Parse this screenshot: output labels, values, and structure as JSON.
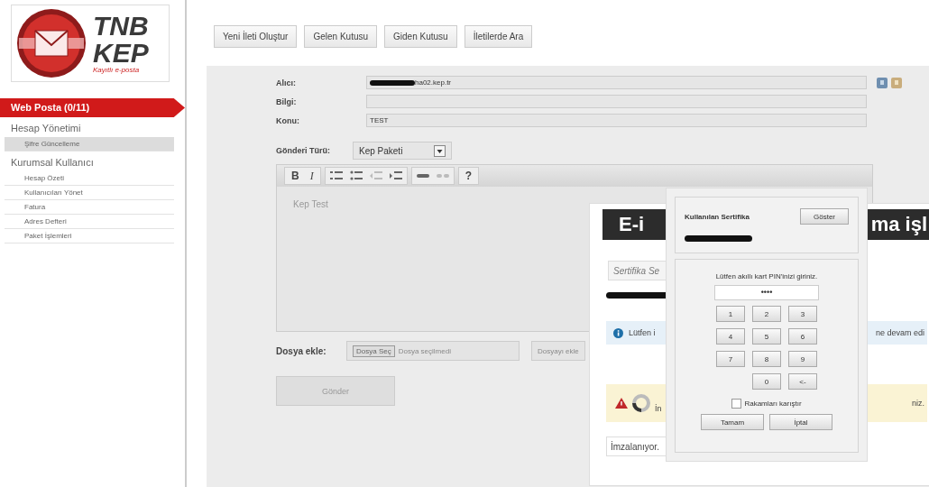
{
  "logo": {
    "line1": "TNB",
    "line2": "KEP",
    "tagline": "Kayıtlı e-posta"
  },
  "sidebar": {
    "items": [
      {
        "label": "Web Posta (0/11)",
        "kind": "primary",
        "selected": true
      },
      {
        "label": "Hesap Yönetimi",
        "kind": "section",
        "children": [
          {
            "label": "Şifre Güncelleme",
            "selected": true
          }
        ]
      },
      {
        "label": "Kurumsal Kullanıcı",
        "kind": "section",
        "children": [
          {
            "label": "Hesap Özeti",
            "selected": false
          },
          {
            "label": "Kullanıcıları Yönet",
            "selected": false
          },
          {
            "label": "Fatura",
            "selected": false
          },
          {
            "label": "Adres Defteri",
            "selected": false
          },
          {
            "label": "Paket İşlemleri",
            "selected": false
          }
        ]
      }
    ]
  },
  "toolbar": [
    "Yeni İleti Oluştur",
    "Gelen Kutusu",
    "Giden Kutusu",
    "İletilerde Ara"
  ],
  "compose": {
    "fields": [
      {
        "label": "Alıcı:",
        "value": "ha02.kep.tr",
        "redacted": true
      },
      {
        "label": "Bilgi:"
      },
      {
        "label": "Konu:",
        "value": "TEST"
      }
    ],
    "type_label": "Gönderi Türü:",
    "type_value": "Kep Paketi",
    "editor": {
      "bold": "B",
      "italic": "I",
      "help": "?",
      "body": "Kep Test"
    },
    "attach_label": "Dosya ekle:",
    "choose_button": "Dosya Seç",
    "no_file": "Dosya seçilmedi",
    "attach_button": "Dosyayı ekle",
    "send_button": "Gönder"
  },
  "sign_dialog": {
    "title_left": "E-i",
    "title_right": "ma işl",
    "cert_placeholder": "Sertifika Se",
    "info_left": "Lütfen i",
    "info_right": "ne devam edi",
    "warning_left": "İn",
    "warning_right": "niz.",
    "status": "İmzalanıyor."
  },
  "pin_dialog": {
    "cert_label": "Kullanılan Sertifika",
    "show_button": "Göster",
    "prompt": "Lütfen akıllı kart PIN'inizi giriniz.",
    "pin": "••••",
    "keys": [
      [
        "1",
        "2",
        "3"
      ],
      [
        "4",
        "5",
        "6"
      ],
      [
        "7",
        "8",
        "9"
      ],
      [
        "0",
        "<-"
      ]
    ],
    "shuffle": {
      "label": "Rakamları karıştır",
      "checked": false
    },
    "ok": "Tamam",
    "cancel": "İptal"
  }
}
